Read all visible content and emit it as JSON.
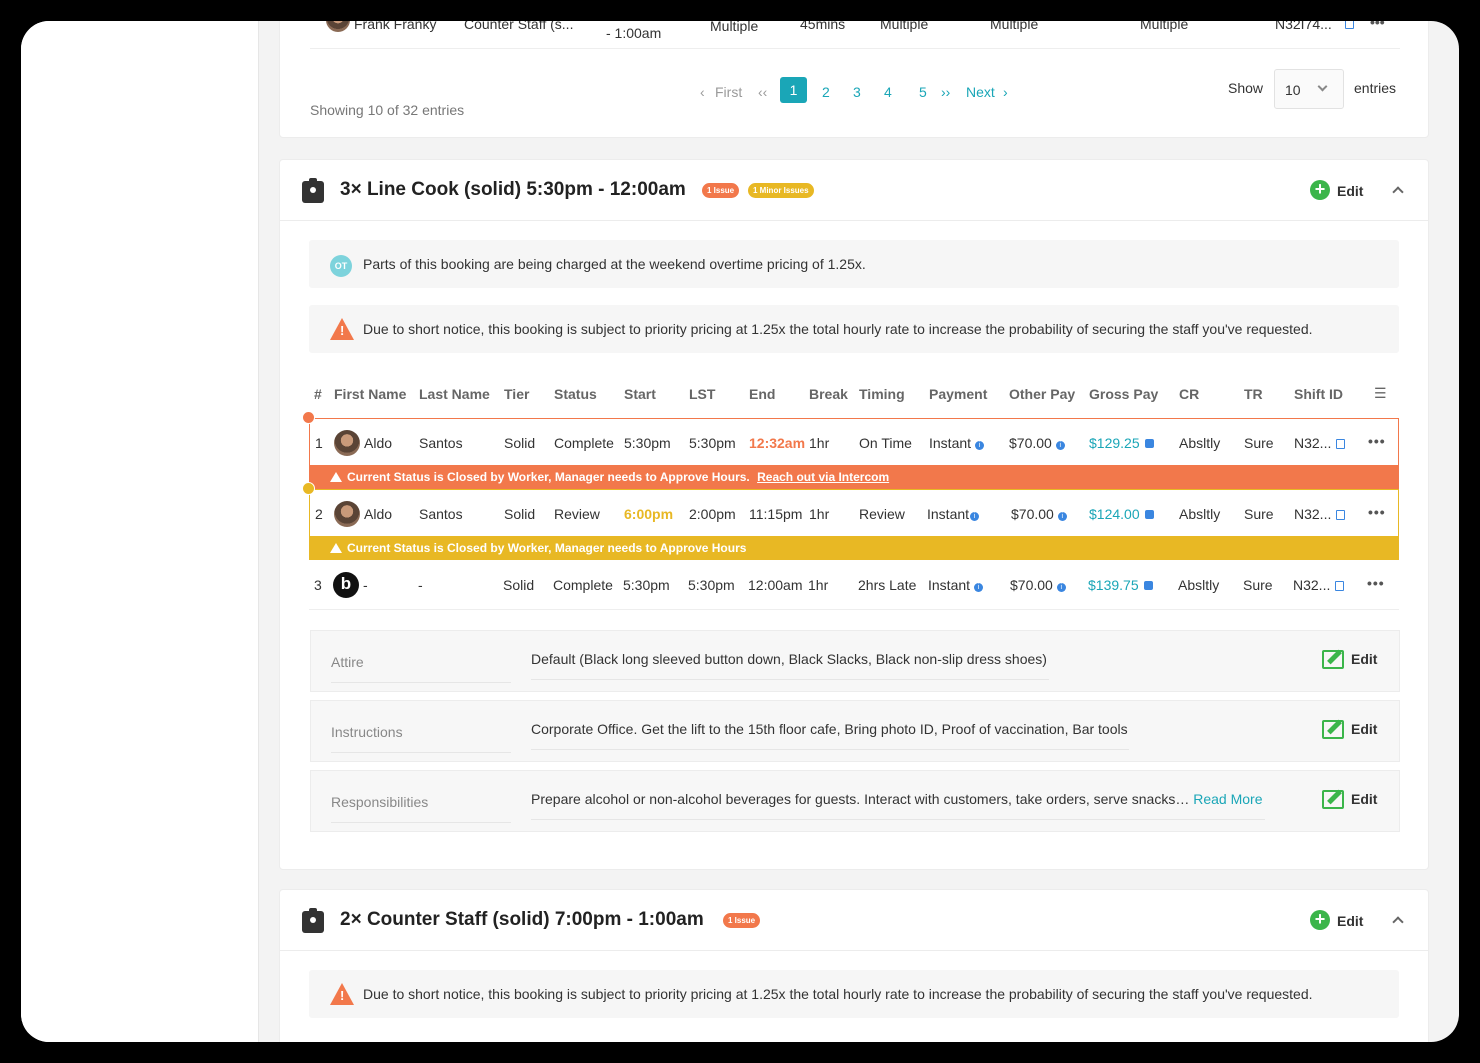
{
  "prev_table": {
    "row": {
      "name": "Frank Franky",
      "role": "Counter Staff (s...",
      "time": "- 1:00am",
      "col1": "Multiple",
      "col2": "45mins",
      "col3": "Multiple",
      "col4": "Multiple",
      "col5": "Multiple",
      "shift_id": "N32I74..."
    },
    "showing": "Showing 10 of 32 entries",
    "pagination": {
      "first": "First",
      "prev": "‹‹",
      "pages": [
        "1",
        "2",
        "3",
        "4",
        "5"
      ],
      "next_arrows": "››",
      "next": "Next"
    },
    "show_label": "Show",
    "show_value": "10",
    "entries_label": "entries"
  },
  "booking1": {
    "title": "3× Line Cook (solid) 5:30pm - 12:00am",
    "badge_issue": "1 Issue",
    "badge_minor": "1 Minor Issues",
    "edit_label": "Edit",
    "notice_ot_icon": "OT",
    "notice_ot": "Parts of this booking are being charged at the weekend overtime pricing of 1.25x.",
    "notice_priority": "Due to short notice, this booking is subject to priority pricing at 1.25x the total hourly rate to increase the probability of securing the staff you've requested.",
    "columns": [
      "#",
      "First Name",
      "Last Name",
      "Tier",
      "Status",
      "Start",
      "LST",
      "End",
      "Break",
      "Timing",
      "Payment",
      "Other Pay",
      "Gross Pay",
      "CR",
      "TR",
      "Shift ID"
    ],
    "rows": [
      {
        "num": "1",
        "first": "Aldo",
        "last": "Santos",
        "tier": "Solid",
        "status": "Complete",
        "start": "5:30pm",
        "lst": "5:30pm",
        "end": "12:32am",
        "break": "1hr",
        "timing": "On Time",
        "payment": "Instant",
        "other_pay": "$70.00",
        "gross_pay": "$129.25",
        "cr": "Absltly",
        "tr": "Sure",
        "shift_id": "N32..."
      },
      {
        "num": "2",
        "first": "Aldo",
        "last": "Santos",
        "tier": "Solid",
        "status": "Review",
        "start": "6:00pm",
        "lst": "2:00pm",
        "end": "11:15pm",
        "break": "1hr",
        "timing": "Review",
        "payment": "Instant",
        "other_pay": "$70.00",
        "gross_pay": "$124.00",
        "cr": "Absltly",
        "tr": "Sure",
        "shift_id": "N32..."
      },
      {
        "num": "3",
        "first": "-",
        "last": "-",
        "tier": "Solid",
        "status": "Complete",
        "start": "5:30pm",
        "lst": "5:30pm",
        "end": "12:00am",
        "break": "1hr",
        "timing": "2hrs Late",
        "payment": "Instant",
        "other_pay": "$70.00",
        "gross_pay": "$139.75",
        "cr": "Absltly",
        "tr": "Sure",
        "shift_id": "N32..."
      }
    ],
    "row1_alert": "Current Status is Closed by Worker, Manager needs to Approve Hours.",
    "row1_alert_link": "Reach out via Intercom",
    "row2_alert": "Current Status is Closed by Worker, Manager needs to Approve Hours",
    "logo_letter": "b",
    "details": [
      {
        "label": "Attire",
        "value": "Default (Black long sleeved button down, Black Slacks, Black non-slip dress shoes)",
        "link": "",
        "edit": "Edit"
      },
      {
        "label": "Instructions",
        "value": "Corporate Office. Get the lift to the 15th floor cafe, Bring photo ID, Proof of vaccination, Bar tools",
        "link": "",
        "edit": "Edit"
      },
      {
        "label": "Responsibilities",
        "value": "Prepare alcohol or non-alcohol beverages for guests. Interact with customers, take orders, serve snacks…",
        "link": "Read More",
        "edit": "Edit"
      }
    ]
  },
  "booking2": {
    "title": "2× Counter Staff (solid) 7:00pm - 1:00am",
    "badge_issue": "1 Issue",
    "edit_label": "Edit",
    "notice_priority": "Due to short notice, this booking is subject to priority pricing at 1.25x the total hourly rate to increase the probability of securing the staff you've requested."
  },
  "colors": {
    "teal": "#1aa6b7",
    "orange": "#f2784b",
    "yellow": "#e8b824",
    "green": "#3bb54a",
    "blue": "#3a86e0"
  }
}
